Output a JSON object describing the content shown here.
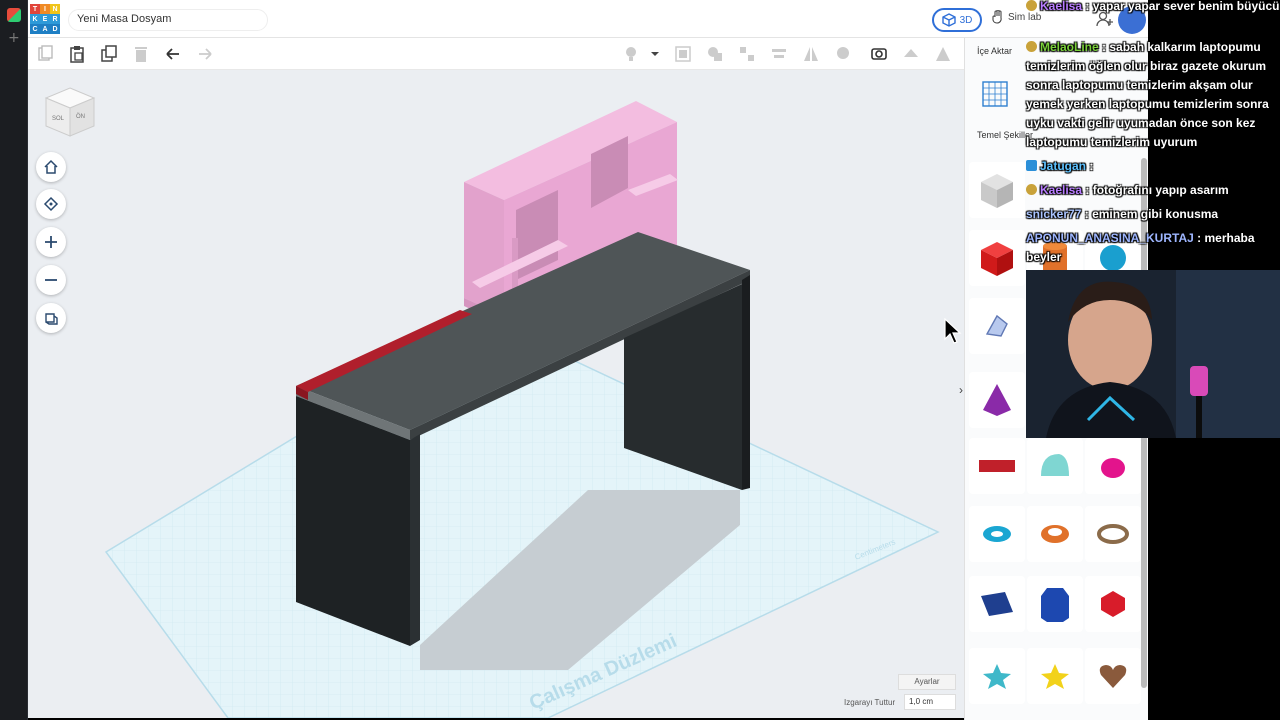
{
  "app": {
    "document_title": "Yeni Masa Dosyam",
    "view_3d_label": "3D",
    "sim_label": "Sim lab"
  },
  "toolbar": {
    "items": [
      "copy-icon",
      "paste-icon",
      "duplicate-icon",
      "delete-icon",
      "undo-icon",
      "redo-icon"
    ],
    "right_items": [
      "light-bulb-icon",
      "group-icon",
      "ungroup-icon",
      "align-icon",
      "mirror-icon",
      "workplane-icon",
      "ruler-icon",
      "export-icon"
    ]
  },
  "workplane": {
    "label": "Çalışma Düzlemi",
    "units_label": "Centimeters",
    "settings_label": "Ayarlar",
    "snap_label": "Izgarayı Tuttur",
    "snap_value": "1,0 cm",
    "viewcube_left": "SOL",
    "viewcube_front": "ÖN"
  },
  "panel": {
    "import_label": "İçe Aktar",
    "category_label": "Temel Şekiller",
    "shapes": [
      "box-striped",
      "cylinder-striped",
      "sphere-striped",
      "box-red",
      "cylinder-orange",
      "sphere-blue",
      "scribble",
      "text-shape",
      "number-shape",
      "pyramid-purple",
      "roof",
      "cone",
      "text-red",
      "half-sphere",
      "paraboloid",
      "torus-blue",
      "tube-orange",
      "ring-brown",
      "wedge-blue",
      "polygon-blue",
      "icosahedron-red",
      "star-teal",
      "star-yellow",
      "heart-brown"
    ]
  },
  "chat": {
    "messages": [
      {
        "user": "Kaelisa",
        "text": ": yapar yapar sever benim büyücü",
        "user_color": "#b87cff"
      },
      {
        "user": "MelaoLine",
        "text": ": sabah kalkarım laptopumu temizlerim öğlen olur biraz gazete okurum sonra laptopumu temizlerim akşam olur yemek yerken laptopumu temizlerim sonra uyku vakti gelir uyumadan önce son kez laptopumu temizlerim uyurum",
        "user_color": "#7ad03a"
      },
      {
        "user": "Jatugan",
        "text": ":",
        "user_color": "#5ec2ff"
      },
      {
        "user": "Kaelisa",
        "text": ": fotoğrafını yapıp asarım",
        "user_color": "#b87cff"
      },
      {
        "user": "snicker77",
        "text": ": eminem gibi konusma",
        "user_color": "#aac4ff"
      },
      {
        "user": "APONUN_ANASINA_KURTAJ",
        "text": ": merhaba beyler",
        "user_color": "#9eb6ff"
      }
    ]
  },
  "colors": {
    "accent": "#2f6fd8",
    "workplane_bg": "#ebeef2",
    "grid_fill": "#dff1f7",
    "desk_top": "#4d5355",
    "desk_side": "#2a2e30",
    "shelf_pink": "#e9a7d3",
    "red_strip": "#b01f2c"
  }
}
